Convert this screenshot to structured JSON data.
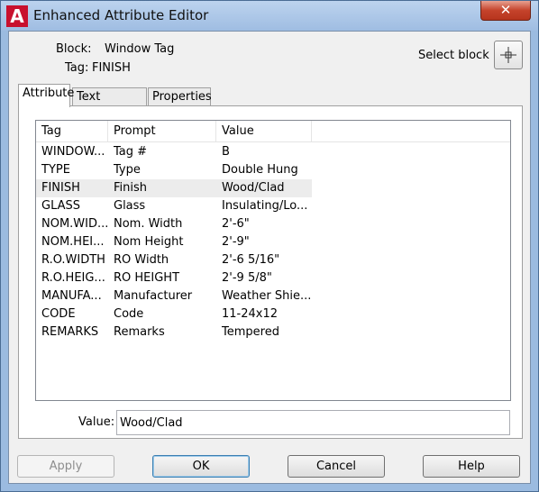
{
  "window": {
    "title": "Enhanced Attribute Editor",
    "app_icon_letter": "A",
    "close_glyph": "✕"
  },
  "block_info": {
    "block_label": "Block:",
    "block_value": "Window Tag",
    "tag_label": "Tag:",
    "tag_value": "FINISH"
  },
  "select_block": {
    "label": "Select block",
    "icon": "crosshair-pick-icon"
  },
  "tabs": [
    {
      "label": "Attribute",
      "active": true
    },
    {
      "label": "Text Options",
      "active": false
    },
    {
      "label": "Properties",
      "active": false
    }
  ],
  "table": {
    "columns": [
      "Tag",
      "Prompt",
      "Value"
    ],
    "rows": [
      {
        "tag": "WINDOW...",
        "prompt": "Tag #",
        "value": "B"
      },
      {
        "tag": "TYPE",
        "prompt": "Type",
        "value": "Double Hung"
      },
      {
        "tag": "FINISH",
        "prompt": "Finish",
        "value": "Wood/Clad"
      },
      {
        "tag": "GLASS",
        "prompt": "Glass",
        "value": "Insulating/Lo..."
      },
      {
        "tag": "NOM.WID...",
        "prompt": "Nom. Width",
        "value": "2'-6\""
      },
      {
        "tag": "NOM.HEI...",
        "prompt": "Nom Height",
        "value": "2'-9\""
      },
      {
        "tag": "R.O.WIDTH",
        "prompt": "RO Width",
        "value": "2'-6 5/16\""
      },
      {
        "tag": "R.O.HEIG...",
        "prompt": "RO HEIGHT",
        "value": "2'-9 5/8\""
      },
      {
        "tag": "MANUFA...",
        "prompt": "Manufacturer",
        "value": "Weather Shie..."
      },
      {
        "tag": "CODE",
        "prompt": "Code",
        "value": "11-24x12"
      },
      {
        "tag": "REMARKS",
        "prompt": "Remarks",
        "value": "Tempered"
      }
    ],
    "selected_row": 2
  },
  "value_field": {
    "label": "Value:",
    "value": "Wood/Clad"
  },
  "buttons": {
    "apply": "Apply",
    "ok": "OK",
    "cancel": "Cancel",
    "help": "Help"
  },
  "colors": {
    "accent": "#3c7fb1",
    "close": "#c5432b",
    "app_icon": "#c8102e"
  }
}
